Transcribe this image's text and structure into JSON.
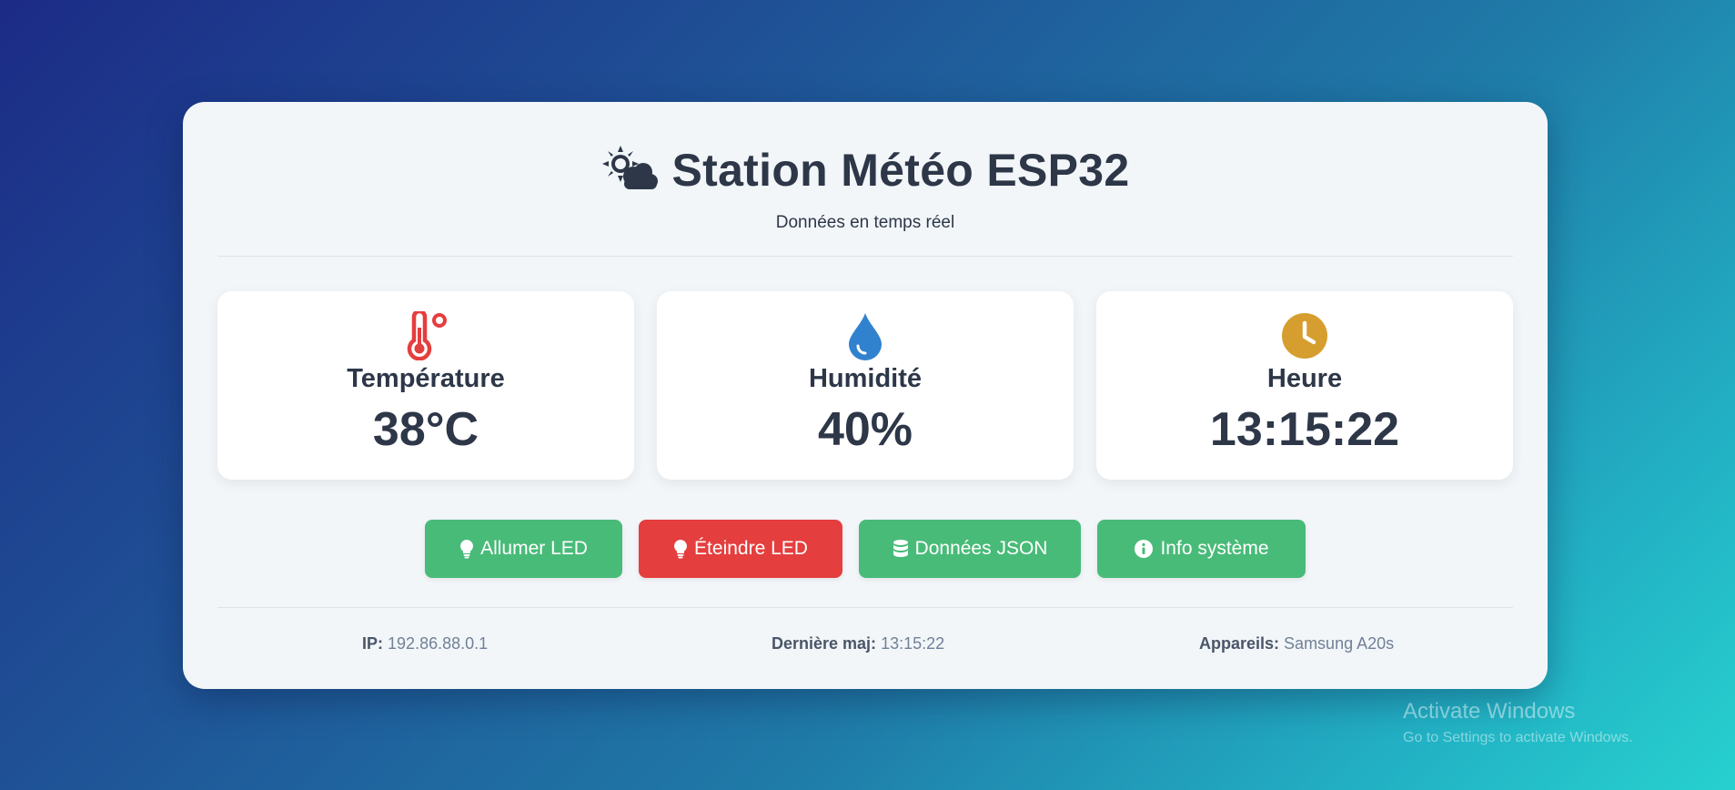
{
  "header": {
    "title": "Station Météo ESP32",
    "subtitle": "Données en temps réel",
    "icon": "cloud-sun-icon"
  },
  "stats": [
    {
      "label": "Température",
      "value": "38°C",
      "icon": "thermometer-icon",
      "color": "#e53e3e"
    },
    {
      "label": "Humidité",
      "value": "40%",
      "icon": "droplet-icon",
      "color": "#3182ce"
    },
    {
      "label": "Heure",
      "value": "13:15:22",
      "icon": "clock-icon",
      "color": "#d69e2e"
    }
  ],
  "buttons": {
    "led_on": {
      "label": "Allumer LED",
      "icon": "lightbulb-icon",
      "color": "#48bb78"
    },
    "led_off": {
      "label": "Éteindre LED",
      "icon": "lightbulb-icon",
      "color": "#e53e3e"
    },
    "json": {
      "label": "Données JSON",
      "icon": "database-icon",
      "color": "#48bb78"
    },
    "info": {
      "label": "Info système",
      "icon": "info-circle-icon",
      "color": "#48bb78"
    }
  },
  "footer": {
    "ip_label": "IP:",
    "ip_value": "192.86.88.0.1",
    "update_label": "Dernière maj:",
    "update_value": "13:15:22",
    "devices_label": "Appareils:",
    "devices_value": "Samsung A20s"
  },
  "watermark": {
    "title": "Activate Windows",
    "subtitle": "Go to Settings to activate Windows."
  }
}
